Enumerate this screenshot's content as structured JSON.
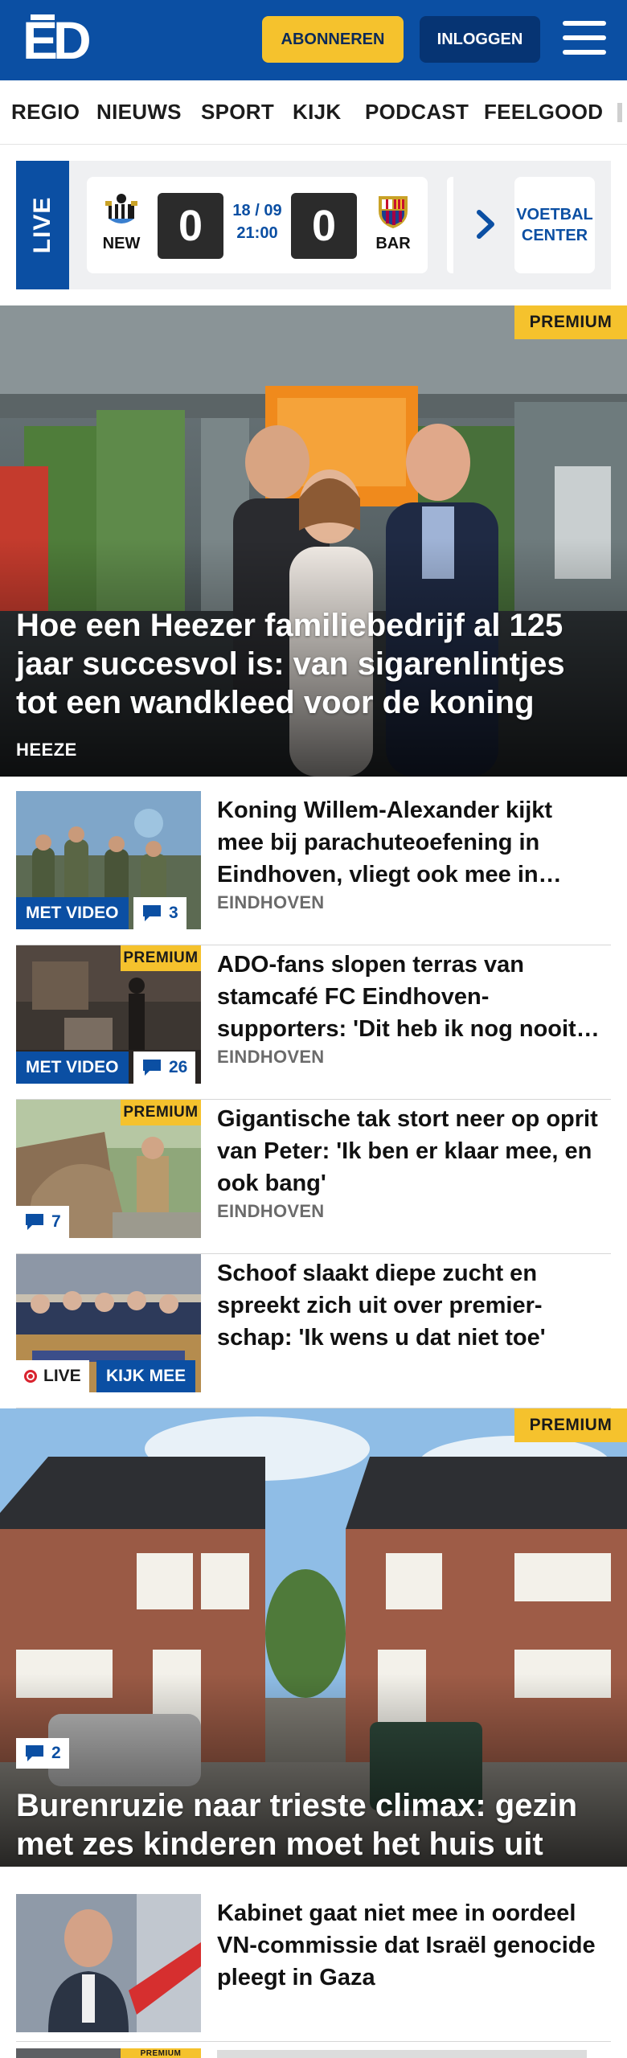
{
  "header": {
    "logo": "ED",
    "subscribe_label": "ABONNEREN",
    "login_label": "INLOGGEN",
    "brand_color": "#0b4fa3",
    "accent_color": "#f5c22d"
  },
  "nav": {
    "items": [
      "REGIO",
      "NIEUWS",
      "SPORT",
      "KIJK",
      "PODCAST",
      "FEELGOOD"
    ]
  },
  "live": {
    "tag": "LIVE",
    "match": {
      "home": "NEW",
      "away": "BAR",
      "home_score": "0",
      "away_score": "0",
      "date": "18 / 09",
      "time": "21:00"
    },
    "voetbal_center": "VOETBAL CENTER"
  },
  "hero1": {
    "premium": "PREMIUM",
    "title": "Hoe een Heezer familiebedrijf al 125 jaar succesvol is: van sigarenlintjes tot een wandkleed voor de koning",
    "location": "HEEZE"
  },
  "articles": [
    {
      "title": "Koning Willem-Alexander kijkt mee bij parachuteoefening in Eindhoven, vliegt ook mee in…",
      "location": "EINDHOVEN",
      "video_label": "MET VIDEO",
      "comments": "3"
    },
    {
      "title": "ADO-fans slopen terras van stamcafé FC Eindhoven-supporters: 'Dit heb ik nog nooit…",
      "location": "EINDHOVEN",
      "video_label": "MET VIDEO",
      "comments": "26",
      "premium": "PREMIUM"
    },
    {
      "title": "Gigantische tak stort neer op oprit van Peter: 'Ik ben er klaar mee, en ook bang'",
      "location": "EINDHOVEN",
      "comments": "7",
      "premium": "PREMIUM"
    },
    {
      "title": "Schoof slaakt diepe zucht en spreekt zich uit over premier-schap: 'Ik wens u dat niet toe'",
      "live_label": "LIVE",
      "watch_label": "KIJK MEE"
    }
  ],
  "hero2": {
    "premium": "PREMIUM",
    "title": "Burenruzie naar trieste climax: gezin met zes kinderen moet het huis uit",
    "comments": "2"
  },
  "article5": {
    "title": "Kabinet gaat niet mee in oordeel VN-commissie dat Israël genocide pleegt in Gaza"
  },
  "article6": {
    "premium": "PREMIUM"
  }
}
